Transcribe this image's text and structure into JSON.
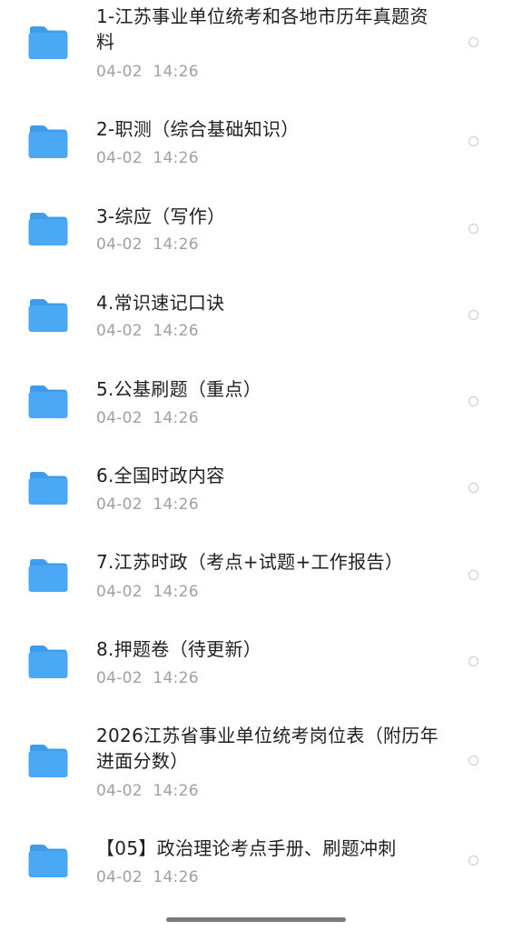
{
  "items": [
    {
      "name": "1-江苏事业单位统考和各地市历年真题资料",
      "date": "04-02",
      "time": "14:26"
    },
    {
      "name": "2-职测（综合基础知识）",
      "date": "04-02",
      "time": "14:26"
    },
    {
      "name": "3-综应（写作）",
      "date": "04-02",
      "time": "14:26"
    },
    {
      "name": "4.常识速记口诀",
      "date": "04-02",
      "time": "14:26"
    },
    {
      "name": "5.公基刷题（重点）",
      "date": "04-02",
      "time": "14:26"
    },
    {
      "name": "6.全国时政内容",
      "date": "04-02",
      "time": "14:26"
    },
    {
      "name": "7.江苏时政（考点+试题+工作报告）",
      "date": "04-02",
      "time": "14:26"
    },
    {
      "name": "8.押题卷（待更新）",
      "date": "04-02",
      "time": "14:26"
    },
    {
      "name": "2026江苏省事业单位统考岗位表（附历年进面分数）",
      "date": "04-02",
      "time": "14:26"
    },
    {
      "name": "【05】政治理论考点手册、刷题冲刺",
      "date": "04-02",
      "time": "14:26"
    }
  ],
  "item_icon": "folder-icon",
  "selection_icon": "radio-unchecked-icon",
  "colors": {
    "folder": "#4aa8f5",
    "folder_tab": "#3d9cec",
    "title_text": "#1f1f1f",
    "meta_text": "#9ea0a6",
    "radio_border": "#c9c9c9"
  }
}
